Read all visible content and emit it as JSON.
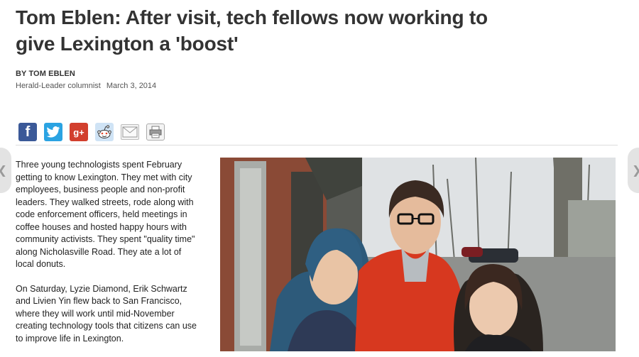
{
  "article": {
    "headline": "Tom Eblen: After visit, tech fellows now working to give Lexington a 'boost'",
    "byline": "BY TOM EBLEN",
    "role": "Herald-Leader columnist",
    "date": "March 3, 2014",
    "paragraphs": [
      "Three young technologists spent February getting to know Lexington. They met with city employees, business people and non-profit leaders. They walked streets, rode along with code enforcement officers, held meetings in coffee houses and hosted happy hours with community activists. They spent \"quality time\" along Nicholasville Road. They ate a lot of local donuts.",
      "On Saturday, Lyzie Diamond, Erik Schwartz and Livien Yin flew back to San Francisco, where they will work until mid-November creating technology tools that citizens can use to improve life in Lexington."
    ]
  },
  "share": {
    "icons": [
      {
        "name": "facebook-icon",
        "glyph": "f",
        "color": "#3b5998"
      },
      {
        "name": "twitter-icon",
        "glyph": "t",
        "color": "#2ba3e2"
      },
      {
        "name": "google-plus-icon",
        "glyph": "g+",
        "color": "#d23f2d"
      },
      {
        "name": "reddit-icon",
        "glyph": "",
        "color": "#cfe3f5"
      },
      {
        "name": "email-icon",
        "glyph": "",
        "color": "#f4f4f4"
      },
      {
        "name": "print-icon",
        "glyph": "",
        "color": "#f4f4f4"
      }
    ]
  },
  "navigation": {
    "prev_icon": "chevron-left-icon",
    "next_icon": "chevron-right-icon"
  },
  "colors": {
    "headline": "#333333",
    "divider": "#dddddd",
    "coat_red": "#d7381f",
    "hair_blue": "#2d5a7a"
  }
}
